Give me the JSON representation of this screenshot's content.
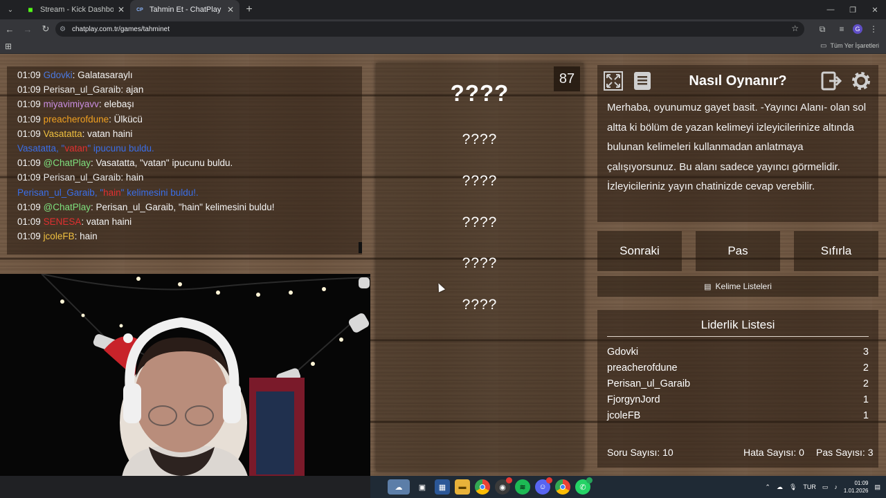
{
  "browser": {
    "tabs": [
      {
        "title": "Stream - Kick Dashboard",
        "favicon": "kick-icon",
        "active": false
      },
      {
        "title": "Tahmin Et - ChatPlay",
        "favicon": "chatplay-icon",
        "active": true
      }
    ],
    "url": "chatplay.com.tr/games/tahminet",
    "bookmarks_all_label": "Tüm Yer İşaretleri"
  },
  "chat": {
    "messages": [
      {
        "time": "01:09",
        "user": "Gdovki",
        "user_color": "#4a78e0",
        "text": ": Galatasaraylı"
      },
      {
        "time": "01:09",
        "user": "Perisan_ul_Garaib",
        "user_color": "#e8e8e8",
        "text": ": ajan"
      },
      {
        "time": "01:09",
        "user": "miyavimiyavv",
        "user_color": "#c98de0",
        "text": ": elebaşı"
      },
      {
        "time": "01:09",
        "user": "preacherofdune",
        "user_color": "#f0a020",
        "text": ": Ülkücü"
      },
      {
        "time": "01:09",
        "user": "Vasatatta",
        "user_color": "#f0c040",
        "text": ": vatan haini"
      },
      {
        "time": "",
        "user": "",
        "user_color": "",
        "text": "",
        "notice_parts": [
          "Vasatatta, \"",
          "vatan",
          "\" ipucunu buldu."
        ]
      },
      {
        "time": "01:09",
        "user": "@ChatPlay",
        "user_color": "#7ee07e",
        "text": ": Vasatatta, \"vatan\" ipucunu buldu."
      },
      {
        "time": "01:09",
        "user": "Perisan_ul_Garaib",
        "user_color": "#e8e8e8",
        "text": ": hain"
      },
      {
        "time": "",
        "user": "",
        "user_color": "",
        "text": "",
        "notice_parts": [
          "Perisan_ul_Garaib, \"",
          "hain",
          "\" kelimesini buldu!."
        ]
      },
      {
        "time": "01:09",
        "user": "@ChatPlay",
        "user_color": "#7ee07e",
        "text": ": Perisan_ul_Garaib, \"hain\" kelimesini buldu!"
      },
      {
        "time": "01:09",
        "user": "SENESA",
        "user_color": "#e03030",
        "text": ": vatan haini"
      },
      {
        "time": "01:09",
        "user": "jcoleFB",
        "user_color": "#f0c040",
        "text": ": hain"
      }
    ]
  },
  "board": {
    "counter": "87",
    "main_word": "????",
    "forbidden_words": [
      "????",
      "????",
      "????",
      "????",
      "????"
    ]
  },
  "howto": {
    "title": "Nasıl Oynanır?",
    "text": "Merhaba, oyunumuz gayet basit. -Yayıncı Alanı- olan sol altta ki bölüm de yazan kelimeyi izleyicilerinize altında bulunan kelimeleri kullanmadan anlatmaya çalışıyorsunuz. Bu alanı sadece yayıncı görmelidir. İzleyicileriniz yayın chatinizde cevap verebilir.",
    "icons": [
      "fullscreen-icon",
      "notes-icon",
      "exit-icon",
      "gear-icon"
    ]
  },
  "controls": {
    "next": "Sonraki",
    "pass": "Pas",
    "reset": "Sıfırla",
    "word_lists": "Kelime Listeleri"
  },
  "leaderboard": {
    "title": "Liderlik Listesi",
    "rows": [
      {
        "name": "Gdovki",
        "score": "3"
      },
      {
        "name": "preacherofdune",
        "score": "2"
      },
      {
        "name": "Perisan_ul_Garaib",
        "score": "2"
      },
      {
        "name": "FjorgynJord",
        "score": "1"
      },
      {
        "name": "jcoleFB",
        "score": "1"
      }
    ]
  },
  "stats": {
    "questions": "Soru Sayısı: 10",
    "errors": "Hata Sayısı: 0",
    "passes": "Pas Sayısı: 3"
  },
  "taskbar": {
    "language": "TUR",
    "time": "01:09",
    "date": "1.01.2026",
    "apps": [
      "weather-icon",
      "task-view-icon",
      "store-icon",
      "files-icon",
      "chrome-icon",
      "obs-icon",
      "spotify-icon",
      "discord-icon",
      "chrome-profile-icon",
      "whatsapp-icon"
    ]
  }
}
